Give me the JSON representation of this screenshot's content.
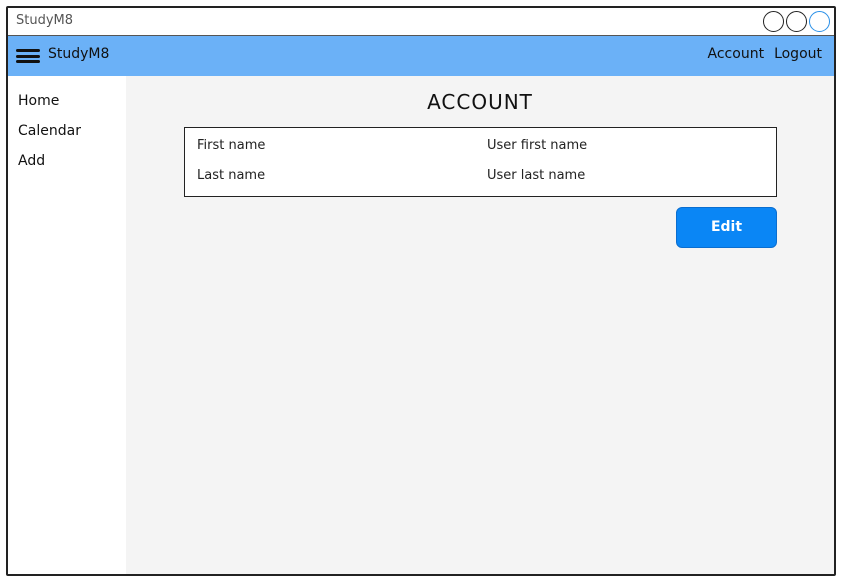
{
  "window": {
    "title": "StudyM8",
    "controls": [
      "minimize-icon",
      "restore-icon",
      "maximize-icon"
    ]
  },
  "navbar": {
    "menu_icon": "hamburger-menu-icon",
    "brand": "StudyM8",
    "links": [
      {
        "label": "Account"
      },
      {
        "label": "Logout"
      }
    ],
    "background_color": "#6bb1f7"
  },
  "sidebar": {
    "items": [
      {
        "label": "Home"
      },
      {
        "label": "Calendar"
      },
      {
        "label": "Add"
      }
    ]
  },
  "main": {
    "title": "ACCOUNT",
    "fields": [
      {
        "label": "First name",
        "value": "User first name"
      },
      {
        "label": "Last name",
        "value": "User last name"
      }
    ],
    "edit_button_label": "Edit",
    "edit_button_color": "#0a86f5",
    "background_color": "#f4f4f4"
  }
}
